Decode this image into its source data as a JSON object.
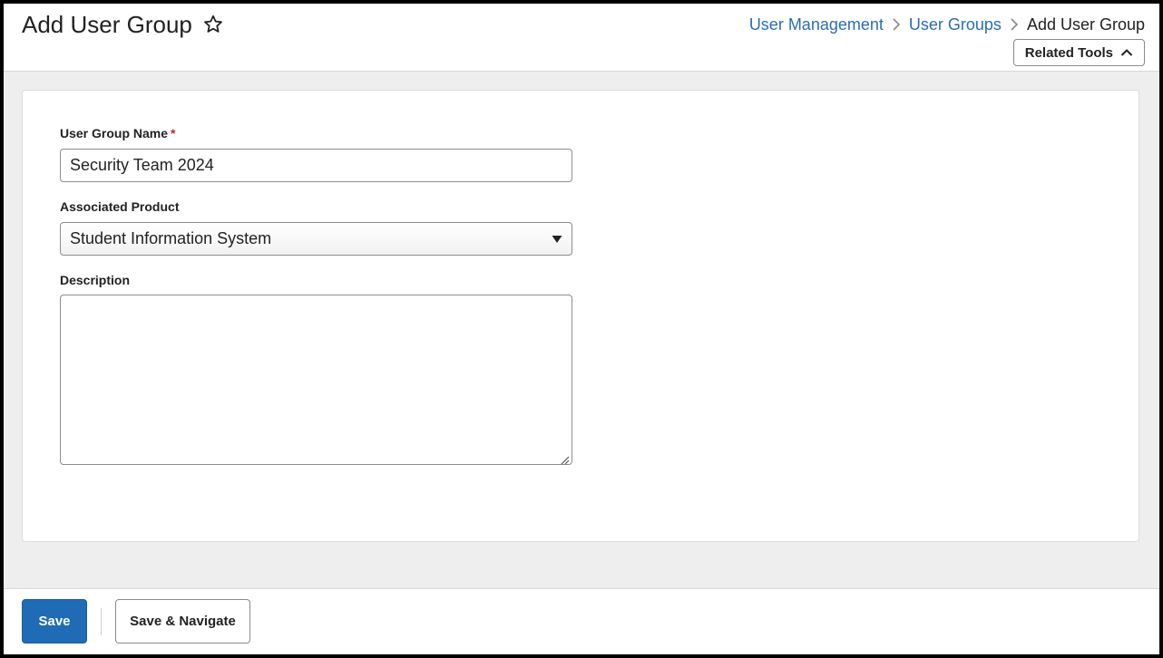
{
  "header": {
    "title": "Add User Group",
    "favorite_icon": "star-outline-icon",
    "breadcrumb": [
      {
        "label": "User Management"
      },
      {
        "label": "User Groups"
      },
      {
        "label": "Add User Group"
      }
    ],
    "related_tools_label": "Related Tools",
    "related_tools_icon": "chevron-up-icon"
  },
  "form": {
    "user_group_name": {
      "label": "User Group Name",
      "required_mark": "*",
      "value": "Security Team 2024"
    },
    "associated_product": {
      "label": "Associated Product",
      "value": "Student Information System",
      "icon": "caret-down-icon"
    },
    "description": {
      "label": "Description",
      "value": ""
    }
  },
  "footer": {
    "save_label": "Save",
    "save_navigate_label": "Save & Navigate"
  },
  "colors": {
    "link": "#2a6db5",
    "primary_button": "#1f6bb5",
    "required": "#c62828",
    "background": "#eeeeee"
  }
}
